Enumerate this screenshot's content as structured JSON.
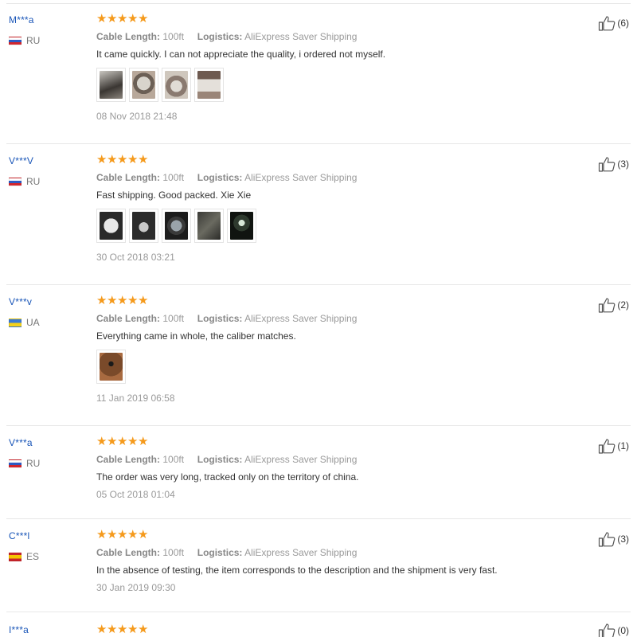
{
  "reviews": [
    {
      "user": "M***a",
      "country": "RU",
      "flag": "ru",
      "rating": 5,
      "cable_label": "Cable Length:",
      "cable_value": "100ft",
      "logistics_label": "Logistics:",
      "logistics_value": "AliExpress Saver Shipping",
      "text": "It came quickly. I can not appreciate the quality, i ordered not myself.",
      "date": "08 Nov 2018 21:48",
      "likes": "(6)",
      "images": 4
    },
    {
      "user": "V***V",
      "country": "RU",
      "flag": "ru",
      "rating": 5,
      "cable_label": "Cable Length:",
      "cable_value": "100ft",
      "logistics_label": "Logistics:",
      "logistics_value": "AliExpress Saver Shipping",
      "text": "Fast shipping. Good packed. Xie Xie",
      "date": "30 Oct 2018 03:21",
      "likes": "(3)",
      "images": 5
    },
    {
      "user": "V***v",
      "country": "UA",
      "flag": "ua",
      "rating": 5,
      "cable_label": "Cable Length:",
      "cable_value": "100ft",
      "logistics_label": "Logistics:",
      "logistics_value": "AliExpress Saver Shipping",
      "text": "Everything came in whole, the caliber matches.",
      "date": "11 Jan 2019 06:58",
      "likes": "(2)",
      "images": 1
    },
    {
      "user": "V***a",
      "country": "RU",
      "flag": "ru",
      "rating": 5,
      "cable_label": "Cable Length:",
      "cable_value": "100ft",
      "logistics_label": "Logistics:",
      "logistics_value": "AliExpress Saver Shipping",
      "text": "The order was very long, tracked only on the territory of china.",
      "date": "05 Oct 2018 01:04",
      "likes": "(1)",
      "images": 0
    },
    {
      "user": "C***l",
      "country": "ES",
      "flag": "es",
      "rating": 5,
      "cable_label": "Cable Length:",
      "cable_value": "100ft",
      "logistics_label": "Logistics:",
      "logistics_value": "AliExpress Saver Shipping",
      "text": "In the absence of testing, the item corresponds to the description and the shipment is very fast.",
      "date": "30 Jan 2019 09:30",
      "likes": "(3)",
      "images": 0
    },
    {
      "user": "I***a",
      "country": "",
      "flag": "",
      "rating": 5,
      "cable_label": "",
      "cable_value": "",
      "logistics_label": "",
      "logistics_value": "",
      "text": "",
      "date": "",
      "likes": "(0)",
      "images": 0
    }
  ],
  "colors": {
    "username": "#1a56b8",
    "star": "#f59a1c",
    "meta": "#9a9a9a",
    "divider": "#e8e8e8"
  },
  "icons": {
    "like": "thumbs-up-icon",
    "star": "star-icon",
    "flag": "flag-icon"
  }
}
